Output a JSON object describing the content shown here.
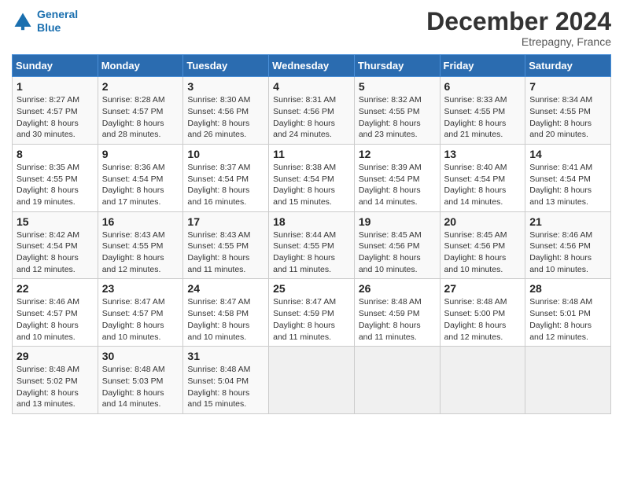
{
  "header": {
    "logo_line1": "General",
    "logo_line2": "Blue",
    "month": "December 2024",
    "location": "Etrepagny, France"
  },
  "days_of_week": [
    "Sunday",
    "Monday",
    "Tuesday",
    "Wednesday",
    "Thursday",
    "Friday",
    "Saturday"
  ],
  "weeks": [
    [
      {
        "day": 1,
        "sunrise": "8:27 AM",
        "sunset": "4:57 PM",
        "daylight": "8 hours and 30 minutes."
      },
      {
        "day": 2,
        "sunrise": "8:28 AM",
        "sunset": "4:57 PM",
        "daylight": "8 hours and 28 minutes."
      },
      {
        "day": 3,
        "sunrise": "8:30 AM",
        "sunset": "4:56 PM",
        "daylight": "8 hours and 26 minutes."
      },
      {
        "day": 4,
        "sunrise": "8:31 AM",
        "sunset": "4:56 PM",
        "daylight": "8 hours and 24 minutes."
      },
      {
        "day": 5,
        "sunrise": "8:32 AM",
        "sunset": "4:55 PM",
        "daylight": "8 hours and 23 minutes."
      },
      {
        "day": 6,
        "sunrise": "8:33 AM",
        "sunset": "4:55 PM",
        "daylight": "8 hours and 21 minutes."
      },
      {
        "day": 7,
        "sunrise": "8:34 AM",
        "sunset": "4:55 PM",
        "daylight": "8 hours and 20 minutes."
      }
    ],
    [
      {
        "day": 8,
        "sunrise": "8:35 AM",
        "sunset": "4:55 PM",
        "daylight": "8 hours and 19 minutes."
      },
      {
        "day": 9,
        "sunrise": "8:36 AM",
        "sunset": "4:54 PM",
        "daylight": "8 hours and 17 minutes."
      },
      {
        "day": 10,
        "sunrise": "8:37 AM",
        "sunset": "4:54 PM",
        "daylight": "8 hours and 16 minutes."
      },
      {
        "day": 11,
        "sunrise": "8:38 AM",
        "sunset": "4:54 PM",
        "daylight": "8 hours and 15 minutes."
      },
      {
        "day": 12,
        "sunrise": "8:39 AM",
        "sunset": "4:54 PM",
        "daylight": "8 hours and 14 minutes."
      },
      {
        "day": 13,
        "sunrise": "8:40 AM",
        "sunset": "4:54 PM",
        "daylight": "8 hours and 14 minutes."
      },
      {
        "day": 14,
        "sunrise": "8:41 AM",
        "sunset": "4:54 PM",
        "daylight": "8 hours and 13 minutes."
      }
    ],
    [
      {
        "day": 15,
        "sunrise": "8:42 AM",
        "sunset": "4:54 PM",
        "daylight": "8 hours and 12 minutes."
      },
      {
        "day": 16,
        "sunrise": "8:43 AM",
        "sunset": "4:55 PM",
        "daylight": "8 hours and 12 minutes."
      },
      {
        "day": 17,
        "sunrise": "8:43 AM",
        "sunset": "4:55 PM",
        "daylight": "8 hours and 11 minutes."
      },
      {
        "day": 18,
        "sunrise": "8:44 AM",
        "sunset": "4:55 PM",
        "daylight": "8 hours and 11 minutes."
      },
      {
        "day": 19,
        "sunrise": "8:45 AM",
        "sunset": "4:56 PM",
        "daylight": "8 hours and 10 minutes."
      },
      {
        "day": 20,
        "sunrise": "8:45 AM",
        "sunset": "4:56 PM",
        "daylight": "8 hours and 10 minutes."
      },
      {
        "day": 21,
        "sunrise": "8:46 AM",
        "sunset": "4:56 PM",
        "daylight": "8 hours and 10 minutes."
      }
    ],
    [
      {
        "day": 22,
        "sunrise": "8:46 AM",
        "sunset": "4:57 PM",
        "daylight": "8 hours and 10 minutes."
      },
      {
        "day": 23,
        "sunrise": "8:47 AM",
        "sunset": "4:57 PM",
        "daylight": "8 hours and 10 minutes."
      },
      {
        "day": 24,
        "sunrise": "8:47 AM",
        "sunset": "4:58 PM",
        "daylight": "8 hours and 10 minutes."
      },
      {
        "day": 25,
        "sunrise": "8:47 AM",
        "sunset": "4:59 PM",
        "daylight": "8 hours and 11 minutes."
      },
      {
        "day": 26,
        "sunrise": "8:48 AM",
        "sunset": "4:59 PM",
        "daylight": "8 hours and 11 minutes."
      },
      {
        "day": 27,
        "sunrise": "8:48 AM",
        "sunset": "5:00 PM",
        "daylight": "8 hours and 12 minutes."
      },
      {
        "day": 28,
        "sunrise": "8:48 AM",
        "sunset": "5:01 PM",
        "daylight": "8 hours and 12 minutes."
      }
    ],
    [
      {
        "day": 29,
        "sunrise": "8:48 AM",
        "sunset": "5:02 PM",
        "daylight": "8 hours and 13 minutes."
      },
      {
        "day": 30,
        "sunrise": "8:48 AM",
        "sunset": "5:03 PM",
        "daylight": "8 hours and 14 minutes."
      },
      {
        "day": 31,
        "sunrise": "8:48 AM",
        "sunset": "5:04 PM",
        "daylight": "8 hours and 15 minutes."
      },
      null,
      null,
      null,
      null
    ]
  ]
}
